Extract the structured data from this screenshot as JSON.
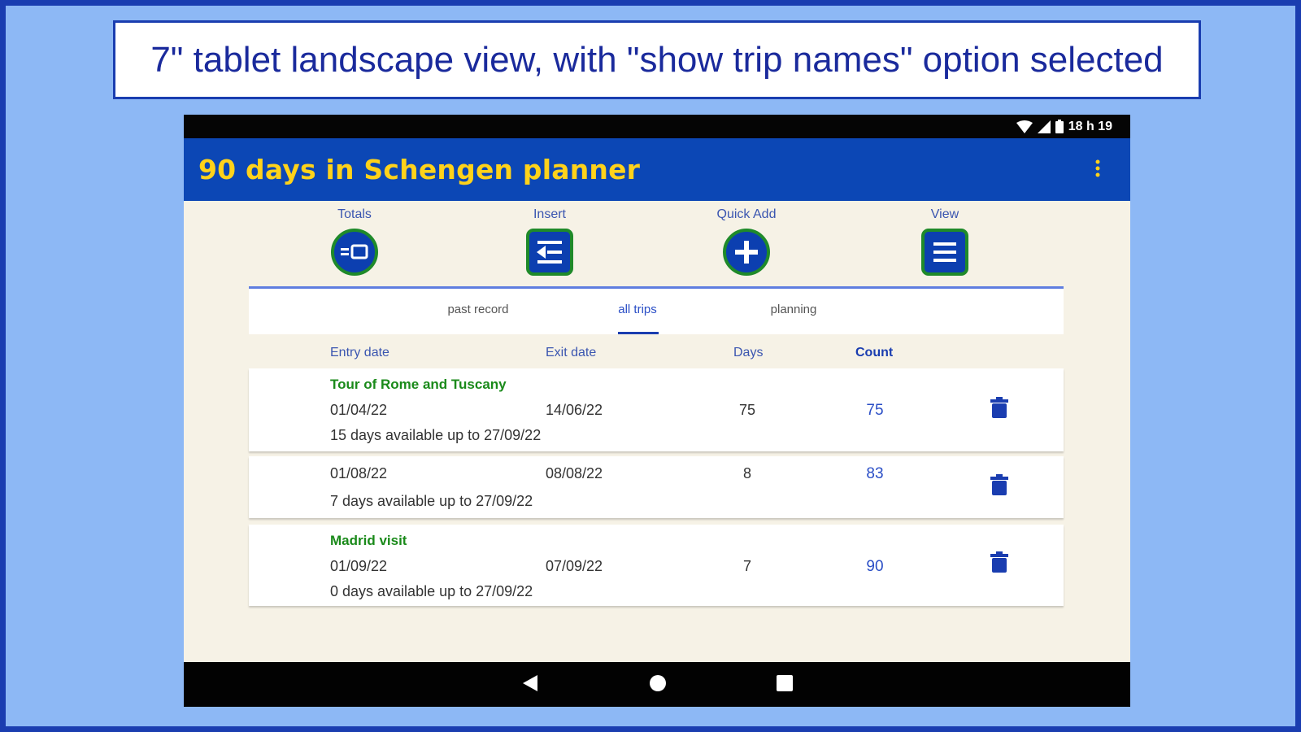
{
  "caption": "7\" tablet landscape view, with \"show trip names\" option selected",
  "status_bar": {
    "time": "18 h 19"
  },
  "app_bar": {
    "title": "90 days in Schengen planner",
    "menu_icon": "overflow-menu-icon"
  },
  "toolbar": {
    "totals_label": "Totals",
    "insert_label": "Insert",
    "quick_add_label": "Quick Add",
    "view_label": "View"
  },
  "tabs": [
    {
      "label": "past record",
      "active": false
    },
    {
      "label": "all trips",
      "active": true
    },
    {
      "label": "planning",
      "active": false
    }
  ],
  "columns": {
    "entry": "Entry date",
    "exit": "Exit date",
    "days": "Days",
    "count": "Count"
  },
  "trips": [
    {
      "name": "Tour of Rome and Tuscany",
      "entry": "01/04/22",
      "exit": "14/06/22",
      "days": "75",
      "count": "75",
      "available": "15 days available up to 27/09/22"
    },
    {
      "name": "",
      "entry": "01/08/22",
      "exit": "08/08/22",
      "days": "8",
      "count": "83",
      "available": "7 days available up to 27/09/22"
    },
    {
      "name": "Madrid visit",
      "entry": "01/09/22",
      "exit": "07/09/22",
      "days": "7",
      "count": "90",
      "available": "0 days available up to 27/09/22"
    }
  ],
  "colors": {
    "app_bar": "#0c47b5",
    "title": "#ffd21a",
    "trip_name": "#1a8a1a",
    "accent": "#2a4ec6"
  }
}
